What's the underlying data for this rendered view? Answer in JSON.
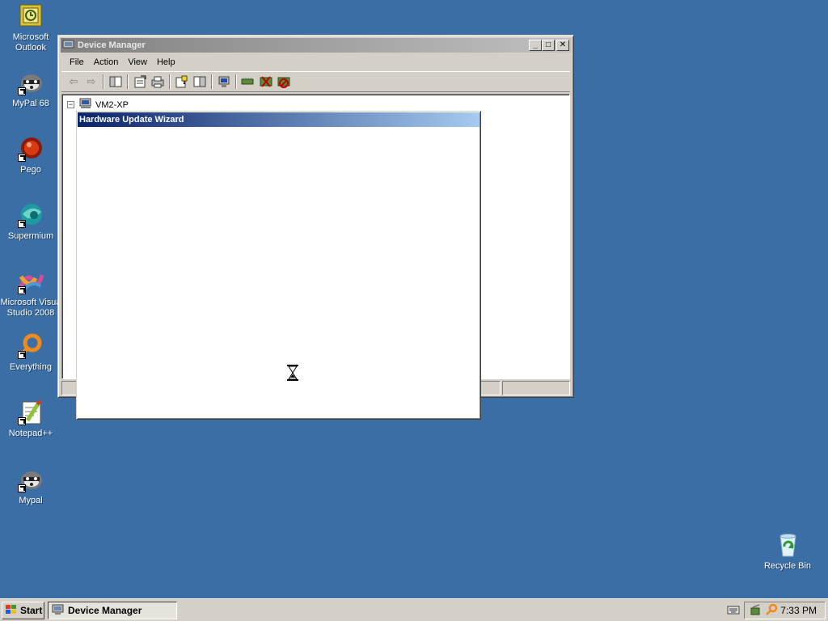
{
  "desktop": {
    "icons": [
      {
        "label": "Microsoft\nOutlook"
      },
      {
        "label": "MyPal 68"
      },
      {
        "label": "Pego"
      },
      {
        "label": "Supermium"
      },
      {
        "label": "Microsoft Visua\nStudio 2008"
      },
      {
        "label": "Everything"
      },
      {
        "label": "Notepad++"
      },
      {
        "label": "Mypal"
      },
      {
        "label": "Recycle Bin"
      }
    ]
  },
  "device_manager": {
    "title": "Device Manager",
    "menu": [
      "File",
      "Action",
      "View",
      "Help"
    ],
    "tree_root": "VM2-XP",
    "expander": "−"
  },
  "wizard": {
    "title": "Hardware Update Wizard"
  },
  "taskbar": {
    "start_label": "Start",
    "task_label": "Device Manager",
    "clock": "7:33 PM"
  }
}
